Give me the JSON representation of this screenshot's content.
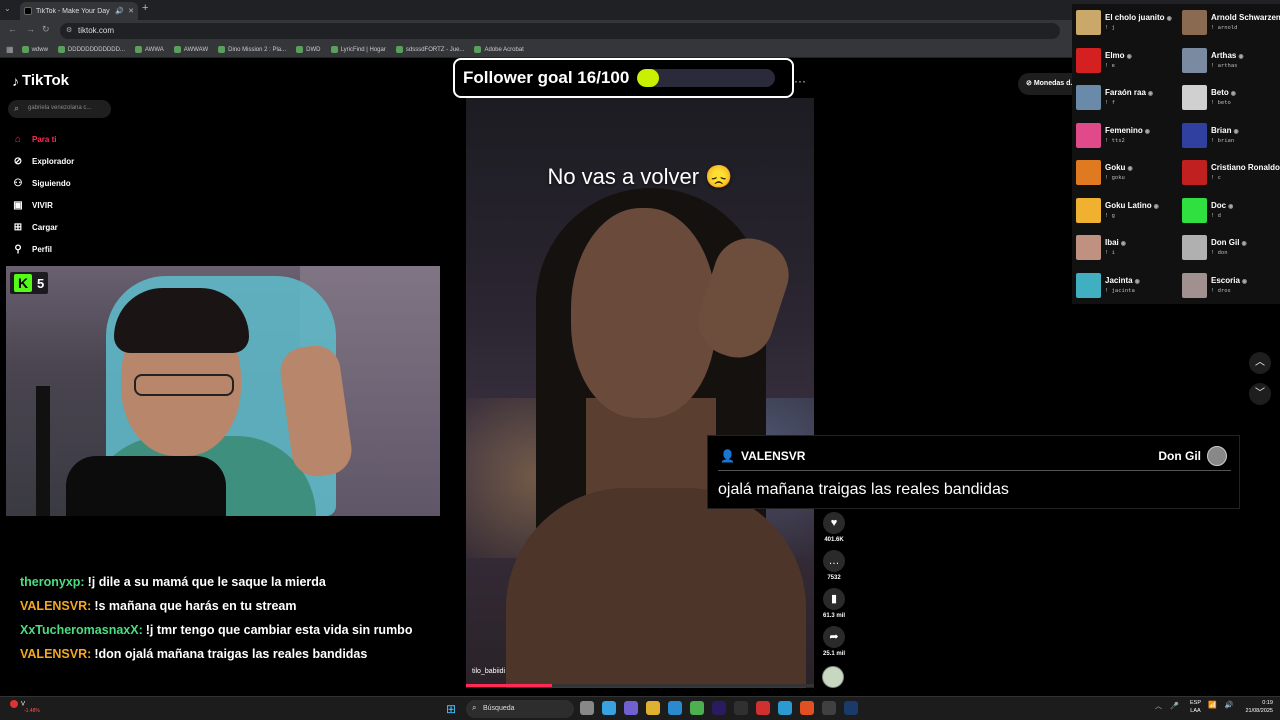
{
  "browser": {
    "tab_title": "TikTok - Make Your Day",
    "url": "tiktok.com",
    "bookmarks": [
      "wdww",
      "DDDDDDDDDDDD...",
      "AWWA",
      "AWWAW",
      "Dino Mission 2 : Pla...",
      "DWD",
      "LyricFind | Hogar",
      "sdsssdFORTZ - Jue...",
      "Adobe Acrobat"
    ]
  },
  "tiktok": {
    "logo": "TikTok",
    "search_placeholder": "gabriela venezolana c...",
    "nav": [
      "Para ti",
      "Explorador",
      "Siguiendo",
      "VIVIR",
      "Cargar",
      "Perfil"
    ],
    "monedas": "Monedas d..."
  },
  "overlay": {
    "kick_count": "5",
    "goal_text": "Follower goal 16/100",
    "goal_current": 16,
    "goal_target": 100
  },
  "chat": [
    {
      "user": "theronyxp:",
      "text": "!j dile a su mamá que le saque la mierda",
      "color": "#4ade80"
    },
    {
      "user": "VALENSVR:",
      "text": "!s mañana que harás en tu stream",
      "color": "#f5a623"
    },
    {
      "user": "XxTucheromasnaxX:",
      "text": "!j tmr tengo que cambiar esta vida sin rumbo",
      "color": "#4ade80"
    },
    {
      "user": "VALENSVR:",
      "text": "!don ojalá mañana traigas las reales bandidas",
      "color": "#f5a623"
    }
  ],
  "video": {
    "caption": "No vas a volver 😞",
    "author": "tilo_babiidi",
    "likes": "401.6K",
    "comments": "7532",
    "saves": "61.3 mil",
    "shares": "25.1 mil"
  },
  "comment": {
    "user": "VALENSVR",
    "recipient": "Don Gil",
    "text": "ojalá mañana traigas las reales bandidas"
  },
  "commands": {
    "left": [
      {
        "name": "El cholo juanito",
        "trigger": "! j",
        "color": "#c9a86a"
      },
      {
        "name": "Elmo",
        "trigger": "! e",
        "color": "#d42020"
      },
      {
        "name": "Faraón raa",
        "trigger": "! f",
        "color": "#6a8aaa"
      },
      {
        "name": "Femenino",
        "trigger": "! tts2",
        "color": "#e04a8a"
      },
      {
        "name": "Goku",
        "trigger": "! goku",
        "color": "#e07a20"
      },
      {
        "name": "Goku Latino",
        "trigger": "! g",
        "color": "#f0b030"
      },
      {
        "name": "Ibai",
        "trigger": "! i",
        "color": "#c09080"
      },
      {
        "name": "Jacinta",
        "trigger": "! jacinta",
        "color": "#40b0c0"
      }
    ],
    "right": [
      {
        "name": "Arnold Schwarzenegger",
        "trigger": "! arnold",
        "color": "#8a6a50"
      },
      {
        "name": "Arthas",
        "trigger": "! arthas",
        "color": "#7a8aa0"
      },
      {
        "name": "Beto",
        "trigger": "! beto",
        "color": "#d0d0d0"
      },
      {
        "name": "Brian",
        "trigger": "! brian",
        "color": "#3040a0"
      },
      {
        "name": "Cristiano Ronaldo",
        "trigger": "! c",
        "color": "#c02020"
      },
      {
        "name": "Doc",
        "trigger": "! d",
        "color": "#30e040"
      },
      {
        "name": "Don Gil",
        "trigger": "! don",
        "color": "#b0b0b0"
      },
      {
        "name": "Escoria",
        "trigger": "! dros",
        "color": "#a09090"
      }
    ]
  },
  "taskbar": {
    "weather_label": "V",
    "weather_change": "-1.48%",
    "search": "Búsqueda",
    "lang_top": "ESP",
    "lang_bottom": "LAA",
    "time": "0:19",
    "date": "21/08/2025"
  }
}
